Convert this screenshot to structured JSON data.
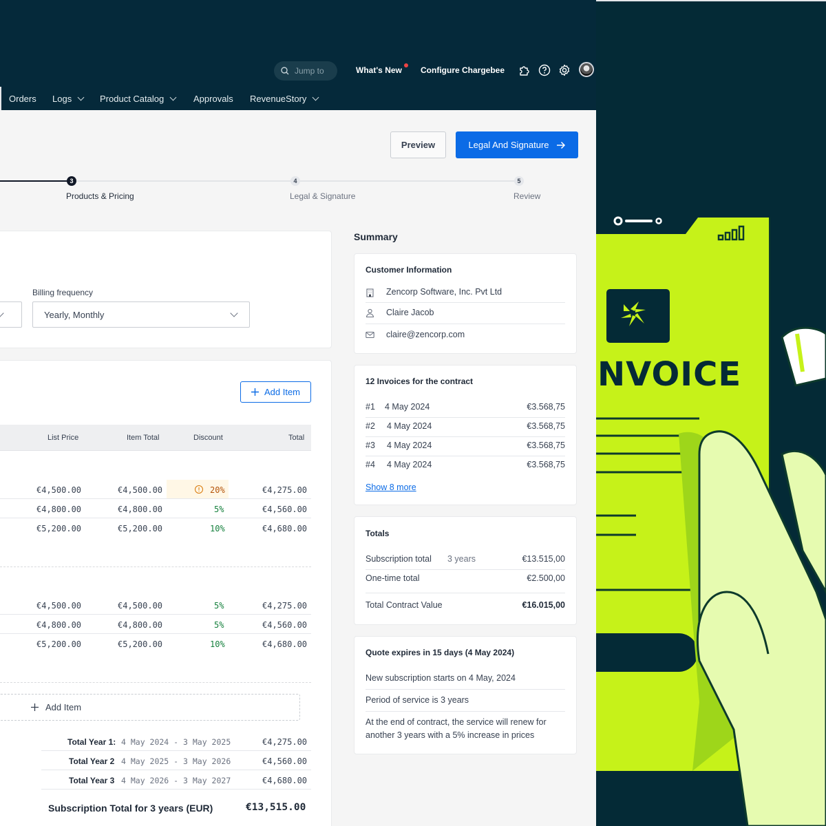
{
  "header": {
    "jump_placeholder": "Jump to",
    "whats_new": "What's New",
    "configure": "Configure Chargebee"
  },
  "nav": {
    "items": [
      {
        "label": "Orders",
        "has_dropdown": false
      },
      {
        "label": "Logs",
        "has_dropdown": true
      },
      {
        "label": "Product Catalog",
        "has_dropdown": true
      },
      {
        "label": "Approvals",
        "has_dropdown": false
      },
      {
        "label": "RevenueStory",
        "has_dropdown": true
      }
    ]
  },
  "actions": {
    "preview": "Preview",
    "legal": "Legal And Signature"
  },
  "steps": [
    {
      "number": "3",
      "label": "Products & Pricing",
      "state": "active"
    },
    {
      "number": "4",
      "label": "Legal & Signature",
      "state": "pending"
    },
    {
      "number": "5",
      "label": "Review",
      "state": "pending"
    }
  ],
  "billing": {
    "label": "Billing frequency",
    "value": "Yearly, Monthly"
  },
  "items": {
    "add_item": "Add Item",
    "columns": {
      "list_price": "List Price",
      "item_total": "Item Total",
      "discount": "Discount",
      "total": "Total"
    },
    "groups": [
      [
        {
          "list_price": "€4,500.00",
          "item_total": "€4,500.00",
          "discount": "20%",
          "total": "€4,275.00",
          "warning": true
        },
        {
          "list_price": "€4,800.00",
          "item_total": "€4,800.00",
          "discount": "5%",
          "total": "€4,560.00",
          "warning": false
        },
        {
          "list_price": "€5,200.00",
          "item_total": "€5,200.00",
          "discount": "10%",
          "total": "€4,680.00",
          "warning": false
        }
      ],
      [
        {
          "list_price": "€4,500.00",
          "item_total": "€4,500.00",
          "discount": "5%",
          "total": "€4,275.00",
          "warning": false
        },
        {
          "list_price": "€4,800.00",
          "item_total": "€4,800.00",
          "discount": "5%",
          "total": "€4,560.00",
          "warning": false
        },
        {
          "list_price": "€5,200.00",
          "item_total": "€5,200.00",
          "discount": "10%",
          "total": "€4,680.00",
          "warning": false
        }
      ]
    ],
    "add_item_bottom": "Add Item",
    "year_totals": [
      {
        "label": "Total Year 1:",
        "range": "4 May 2024 - 3 May 2025",
        "amount": "€4,275.00"
      },
      {
        "label": "Total Year 2",
        "range": "4 May 2025 - 3 May 2026",
        "amount": "€4,560.00"
      },
      {
        "label": "Total Year 3",
        "range": "4 May 2026 - 3 May 2027",
        "amount": "€4,680.00"
      }
    ],
    "subscription_total_label": "Subscription Total for 3 years (EUR)",
    "subscription_total_value": "€13,515.00"
  },
  "summary": {
    "title": "Summary",
    "customer": {
      "title": "Customer Information",
      "company": "Zencorp Software, Inc. Pvt Ltd",
      "contact": "Claire Jacob",
      "email": "claire@zencorp.com"
    },
    "invoices": {
      "title": "12 Invoices for the contract",
      "rows": [
        {
          "num": "#1",
          "date": "4 May 2024",
          "amount": "€3.568,75"
        },
        {
          "num": "#2",
          "date": "4 May 2024",
          "amount": "€3.568,75"
        },
        {
          "num": "#3",
          "date": "4 May 2024",
          "amount": "€3.568,75"
        },
        {
          "num": "#4",
          "date": "4 May 2024",
          "amount": "€3.568,75"
        }
      ],
      "show_more": "Show 8 more"
    },
    "totals": {
      "title": "Totals",
      "subscription_label": "Subscription total",
      "subscription_term": "3 years",
      "subscription_value": "€13.515,00",
      "onetime_label": "One-time total",
      "onetime_value": "€2.500,00",
      "tcv_label": "Total Contract Value",
      "tcv_value": "€16.015,00"
    },
    "quote": {
      "title": "Quote expires in 15 days (4 May 2024)",
      "line1": "New subscription starts on 4 May, 2024",
      "line2": "Period of service is 3 years",
      "line3a": "At the end of contract, the service will renew for",
      "line3b": "another 3 years with a 5% increase in prices"
    }
  },
  "illustration": {
    "title": "NVOICE"
  },
  "colors": {
    "nav_bg": "#05293a",
    "primary": "#0b6be6",
    "lime": "#c6f219",
    "success": "#15803d",
    "warning": "#d97706"
  }
}
